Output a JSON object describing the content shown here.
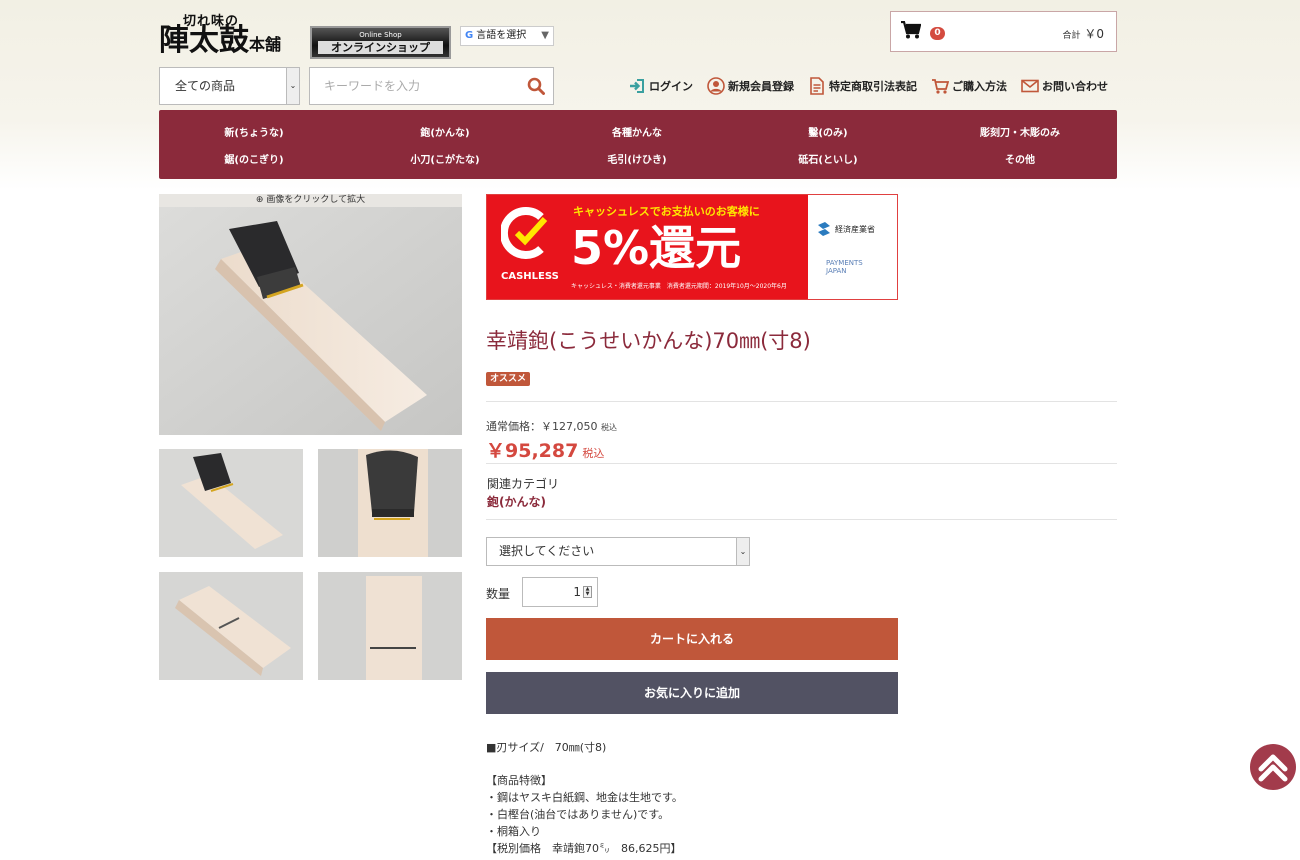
{
  "header": {
    "logo_small": "切れ味の",
    "logo_main": "陣太鼓",
    "logo_suffix": "本舗",
    "shop_badge_line1": "Online Shop",
    "shop_badge_line2": "オンラインショップ",
    "language_label": "言語を選択",
    "language_g": "G",
    "language_arrow": "▼"
  },
  "cart": {
    "count": "0",
    "total_prefix": "合計",
    "total": "￥0"
  },
  "search": {
    "category": "全ての商品",
    "placeholder": "キーワードを入力",
    "dropdown_glyph": "⌄"
  },
  "util_nav": {
    "login": "ログイン",
    "register": "新規会員登録",
    "law": "特定商取引法表記",
    "howto": "ご購入方法",
    "contact": "お問い合わせ"
  },
  "categories": [
    "新(ちょうな)",
    "鉋(かんな)",
    "各種かんな",
    "鑿(のみ)",
    "彫刻刀・木彫のみ",
    "鋸(のこぎり)",
    "小刀(こがたな)",
    "毛引(けひき)",
    "砥石(といし)",
    "その他"
  ],
  "gallery": {
    "zoom_hint": "画像をクリックして拡大"
  },
  "banner": {
    "cashless": "CASHLESS",
    "top_text": "キャッシュレスでお支払いのお客様に",
    "big_text": "5%還元",
    "small_text": "キャッシュレス・消費者還元事業　消費者還元期間：2019年10月〜2020年6月",
    "meti": "経済産業省",
    "pj_line1": "PAYMENTS",
    "pj_line2": "JAPAN"
  },
  "product": {
    "title": "幸靖鉋(こうせいかんな)70㎜(寸8)",
    "badge": "オススメ",
    "regular_label": "通常価格：",
    "regular_price": "￥127,050",
    "tax_label": "税込",
    "sale_price": "￥95,287",
    "related_label": "関連カテゴリ",
    "related_link": "鉋(かんな)",
    "option_placeholder": "選択してください",
    "qty_label": "数量",
    "qty_value": "1",
    "add_to_cart": "カートに入れる",
    "add_to_fav": "お気に入りに追加"
  },
  "description": [
    "■刃サイズ/　70㎜(寸8)",
    "",
    "【商品特徴】",
    "・鋼はヤスキ白紙鋼、地金は生地です。",
    "・白樫台(油台ではありません)です。",
    "・桐箱入り",
    "【税別価格　幸靖鉋70㍉　86,625円】"
  ]
}
